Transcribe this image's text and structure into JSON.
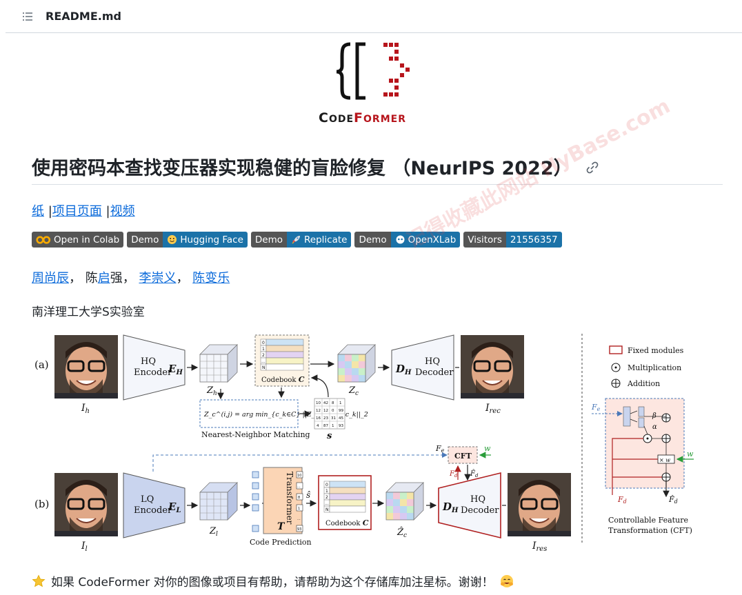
{
  "header": {
    "toc_icon": "list-unordered-icon",
    "file_name": "README.md"
  },
  "logo": {
    "wordmark_c1": "C",
    "wordmark_1": "ODE",
    "wordmark_c2": "F",
    "wordmark_2": "ORMER"
  },
  "title": {
    "text": "使用密码本查找变压器实现稳健的盲脸修复 （NeurIPS 2022）",
    "link_icon": "link-icon"
  },
  "links": {
    "paper": "纸",
    "sep1": " |",
    "project": "项目页面",
    "sep2": " |",
    "video": "视频"
  },
  "badges": [
    {
      "left": "",
      "right": "Open in Colab",
      "icon": "colab-icon",
      "color": "#555555",
      "left_icon": true
    },
    {
      "left": "Demo",
      "right": "Hugging Face",
      "icon": "hugging-face-icon",
      "color": "#1b72a8"
    },
    {
      "left": "Demo",
      "right": "Replicate",
      "icon": "rocket-icon",
      "color": "#1b72a8"
    },
    {
      "left": "Demo",
      "right": "OpenXLab",
      "icon": "openxlab-icon",
      "color": "#1b72a8"
    },
    {
      "left": "Visitors",
      "right": "21556357",
      "icon": "",
      "color": "#1b72a8"
    }
  ],
  "authors": {
    "a1": "周尚辰",
    "sep1": "， ",
    "a2_pre": "陈",
    "a2_link": "启",
    "a2_post": "强",
    "sep2": "， ",
    "a3": "李崇义",
    "sep3": "， ",
    "a4": "陈变乐"
  },
  "affiliation": "南洋理工大学S实验室",
  "watermark": "记得收藏此网站 HyBase.com",
  "figure": {
    "a_label": "(a)",
    "b_label": "(b)",
    "hq_encoder_1": "HQ",
    "hq_encoder_2": "Encoder",
    "eh": "E",
    "eh_sub": "H",
    "zh": "Z",
    "zh_sub": "h",
    "codebook": "Codebook",
    "codebook_sym": "C",
    "cb_rows": [
      "0",
      "1",
      "2",
      "...",
      "N"
    ],
    "zc": "Z",
    "zc_sub": "c",
    "dh": "D",
    "dh_sub": "H",
    "hq_decoder_1": "HQ",
    "hq_decoder_2": "Decoder",
    "ih": "I",
    "ih_sub": "h",
    "irec": "I",
    "irec_sub": "rec",
    "nn_formula": "Z_c^(i,j) = arg min_{c_k∈C} ||Z_h^(i,j) − c_k||_2",
    "nn_caption": "Nearest-Neighbor Matching",
    "s_label": "s",
    "s_matrix": [
      [
        "10",
        "42",
        "8",
        "1"
      ],
      [
        "12",
        "12",
        "0",
        "99"
      ],
      [
        "16",
        "23",
        "31",
        "45"
      ],
      [
        "4",
        "87",
        "1",
        "93"
      ]
    ],
    "fe": "F",
    "fe_sub": "e",
    "cft": "CFT",
    "w": "w",
    "fd": "F",
    "fd_sub": "d",
    "fd_hat": "F̂",
    "lq_encoder_1": "LQ",
    "lq_encoder_2": "Encoder",
    "el": "E",
    "el_sub": "L",
    "zl": "Z",
    "zl_sub": "l",
    "transformer": "Transformer",
    "transformer_sym": "T",
    "code_prediction": "Code Prediction",
    "s_hat": "ŝ",
    "token_labels": [
      "10",
      "...",
      "8",
      "1",
      "...",
      "93"
    ],
    "zc_hat": "Ẑ",
    "il": "I",
    "il_sub": "l",
    "ires": "I",
    "ires_sub": "res",
    "legend_fixed": "Fixed modules",
    "legend_mult": "Multiplication",
    "legend_add": "Addition",
    "cft_alpha": "α",
    "cft_beta": "β",
    "cft_times_w": "× w",
    "cft_caption_1": "Controllable Feature",
    "cft_caption_2": "Transformation (CFT)"
  },
  "footer": {
    "star_icon": "star-icon",
    "text": "如果 CodeFormer 对你的图像或项目有帮助，请帮助为这个存储库加注星标。谢谢！",
    "hug_icon": "hugging-face-icon"
  }
}
